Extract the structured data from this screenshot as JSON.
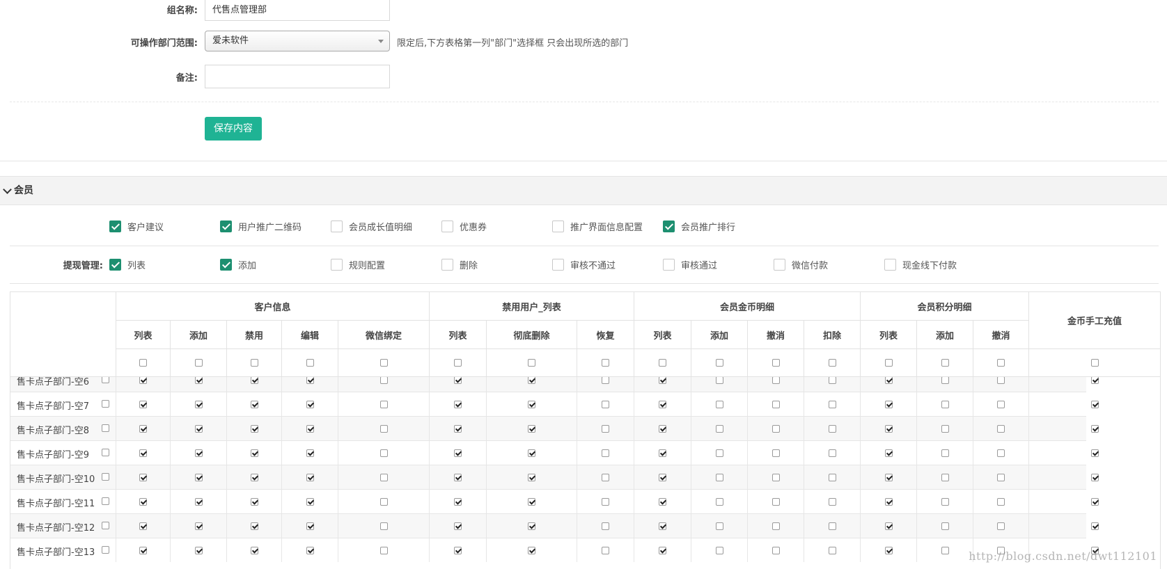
{
  "form": {
    "group_name_label": "组名称:",
    "group_name_value": "代售点管理部",
    "dept_range_label": "可操作部门范围:",
    "dept_range_value": "爱未软件",
    "dept_range_hint": "限定后,下方表格第一列\"部门\"选择框 只会出现所选的部门",
    "remark_label": "备注:",
    "remark_value": "",
    "save_label": "保存内容"
  },
  "section": {
    "title": "会员",
    "row1": [
      {
        "label": "客户建议",
        "checked": true
      },
      {
        "label": "用户推广二维码",
        "checked": true
      },
      {
        "label": "会员成长值明细",
        "checked": false
      },
      {
        "label": "优惠券",
        "checked": false
      },
      {
        "label": "推广界面信息配置",
        "checked": false
      },
      {
        "label": "会员推广排行",
        "checked": true
      }
    ],
    "row2_label": "提现管理:",
    "row2": [
      {
        "label": "列表",
        "checked": true
      },
      {
        "label": "添加",
        "checked": true
      },
      {
        "label": "规则配置",
        "checked": false
      },
      {
        "label": "删除",
        "checked": false
      },
      {
        "label": "审核不通过",
        "checked": false
      },
      {
        "label": "审核通过",
        "checked": false
      },
      {
        "label": "微信付款",
        "checked": false
      },
      {
        "label": "现金线下付款",
        "checked": false
      }
    ]
  },
  "table": {
    "groups": [
      {
        "label": "客户信息",
        "columns": [
          "列表",
          "添加",
          "禁用",
          "编辑",
          "微信绑定"
        ]
      },
      {
        "label": "禁用用户_列表",
        "columns": [
          "列表",
          "彻底删除",
          "恢复"
        ]
      },
      {
        "label": "会员金币明细",
        "columns": [
          "列表",
          "添加",
          "撤消",
          "扣除"
        ]
      },
      {
        "label": "会员积分明细",
        "columns": [
          "列表",
          "添加",
          "撤消"
        ]
      },
      {
        "label": "金币手工充值",
        "columns": []
      }
    ],
    "rows": [
      {
        "name": "售卡点子部门-空6",
        "checks": [
          true,
          true,
          true,
          true,
          false,
          true,
          true,
          false,
          true,
          false,
          false,
          false,
          true,
          false,
          false,
          true
        ]
      },
      {
        "name": "售卡点子部门-空7",
        "checks": [
          true,
          true,
          true,
          true,
          false,
          true,
          true,
          false,
          true,
          false,
          false,
          false,
          true,
          false,
          false,
          true
        ]
      },
      {
        "name": "售卡点子部门-空8",
        "checks": [
          true,
          true,
          true,
          true,
          false,
          true,
          true,
          false,
          true,
          false,
          false,
          false,
          true,
          false,
          false,
          true
        ]
      },
      {
        "name": "售卡点子部门-空9",
        "checks": [
          true,
          true,
          true,
          true,
          false,
          true,
          true,
          false,
          true,
          false,
          false,
          false,
          true,
          false,
          false,
          true
        ]
      },
      {
        "name": "售卡点子部门-空10",
        "checks": [
          true,
          true,
          true,
          true,
          false,
          true,
          true,
          false,
          true,
          false,
          false,
          false,
          true,
          false,
          false,
          true
        ]
      },
      {
        "name": "售卡点子部门-空11",
        "checks": [
          true,
          true,
          true,
          true,
          false,
          true,
          true,
          false,
          true,
          false,
          false,
          false,
          true,
          false,
          false,
          true
        ]
      },
      {
        "name": "售卡点子部门-空12",
        "checks": [
          true,
          true,
          true,
          true,
          false,
          true,
          true,
          false,
          true,
          false,
          false,
          false,
          true,
          false,
          false,
          true
        ]
      },
      {
        "name": "售卡点子部门-空13",
        "checks": [
          true,
          true,
          true,
          true,
          false,
          true,
          true,
          false,
          true,
          false,
          false,
          false,
          true,
          false,
          false,
          true
        ]
      }
    ]
  },
  "watermark": "http://blog.csdn.net/dwt112101"
}
